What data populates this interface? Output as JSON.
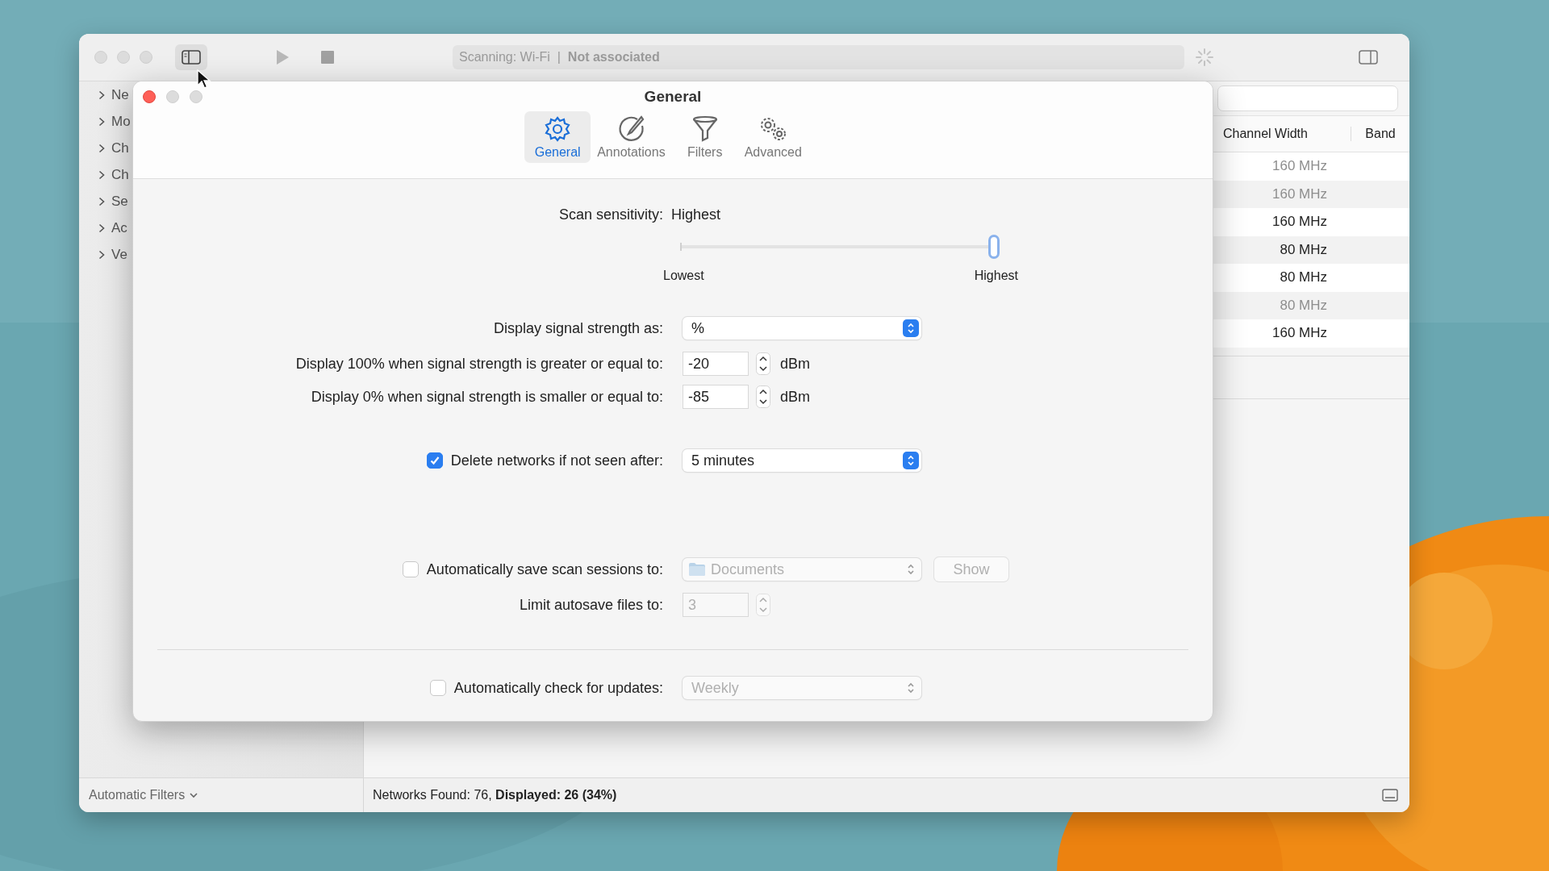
{
  "main_window": {
    "toolbar": {
      "status": "Scanning: Wi-Fi  |  **Not associated**"
    },
    "sidebar": {
      "items": [
        {
          "label": "Ne"
        },
        {
          "label": "Mo"
        },
        {
          "label": "Ch"
        },
        {
          "label": "Ch"
        },
        {
          "label": "Se"
        },
        {
          "label": "Ac"
        },
        {
          "label": "Ve"
        }
      ]
    },
    "table": {
      "columns": [
        "Channel Width",
        "Band"
      ],
      "rows": [
        {
          "channel_width": "160 MHz",
          "dimmed": true
        },
        {
          "channel_width": "160 MHz",
          "dimmed": true
        },
        {
          "channel_width": "160 MHz",
          "dimmed": false
        },
        {
          "channel_width": "80 MHz",
          "dimmed": false
        },
        {
          "channel_width": "80 MHz",
          "dimmed": false
        },
        {
          "channel_width": "80 MHz",
          "dimmed": true
        },
        {
          "channel_width": "160 MHz",
          "dimmed": false
        }
      ]
    },
    "footer": {
      "filter_menu": "Automatic Filters",
      "summary": "Networks Found: 76, **Displayed: 26 (34%)**"
    }
  },
  "preferences": {
    "title": "General",
    "tabs": [
      {
        "label": "General",
        "kind": "gear",
        "selected": true
      },
      {
        "label": "Annotations",
        "kind": "pen",
        "selected": false
      },
      {
        "label": "Filters",
        "kind": "funnel",
        "selected": false
      },
      {
        "label": "Advanced",
        "kind": "gears",
        "selected": false
      }
    ],
    "scan_sensitivity": {
      "label": "Scan sensitivity:",
      "value": "Highest",
      "level": 1,
      "min_label": "Lowest",
      "max_label": "Highest"
    },
    "signal_display": {
      "label": "Display signal strength as:",
      "value": "%"
    },
    "thresholds": [
      {
        "label": "Display 100% when signal strength is greater or equal to:",
        "value": "-20",
        "unit": "dBm"
      },
      {
        "label": "Display 0% when signal strength is smaller or equal to:",
        "value": "-85",
        "unit": "dBm"
      }
    ],
    "delete_networks": {
      "label": "Delete networks if not seen after:",
      "checked": true,
      "value": "5 minutes"
    },
    "autosave": {
      "label": "Automatically save scan sessions to:",
      "checked": false,
      "folder": "Documents",
      "button": "Show"
    },
    "autosave_limit": {
      "label": "Limit autosave files to:",
      "value": "3"
    },
    "updates": {
      "label": "Automatically check for updates:",
      "checked": false,
      "value": "Weekly"
    }
  }
}
